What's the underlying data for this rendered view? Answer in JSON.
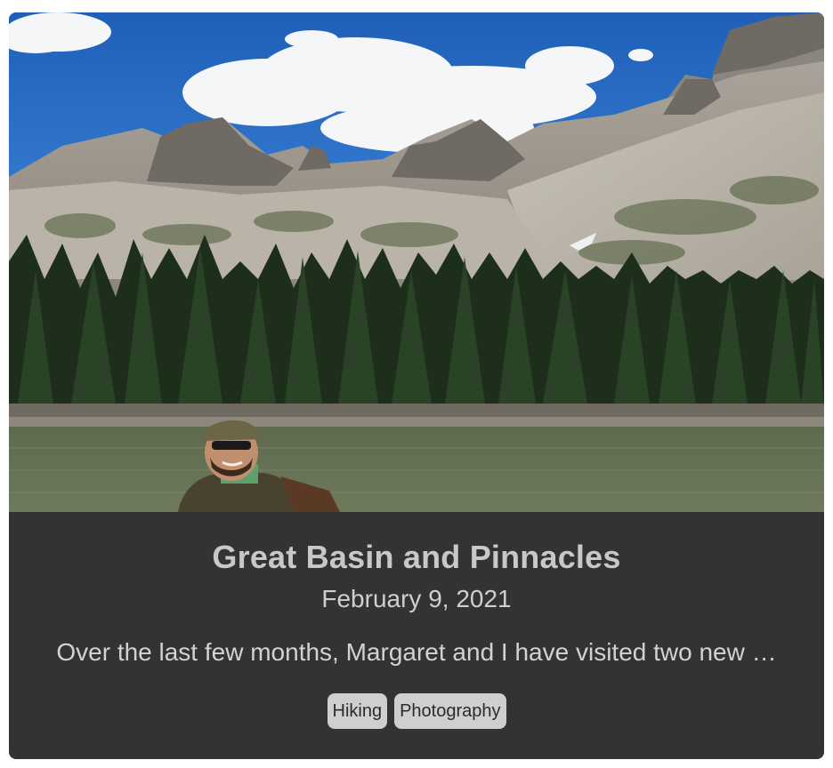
{
  "post": {
    "image_alt": "Hiker smiling in front of an alpine lake below rocky peaks and pine forest",
    "title": "Great Basin and Pinnacles",
    "date": "February 9, 2021",
    "excerpt": "Over the last few months, Margaret and I have visited two new …",
    "tags": [
      {
        "label": "Hiking"
      },
      {
        "label": "Photography"
      }
    ]
  },
  "colors": {
    "card_background": "#333333",
    "tag_background": "#cfcfcf",
    "title_text": "#c8c8c8"
  }
}
